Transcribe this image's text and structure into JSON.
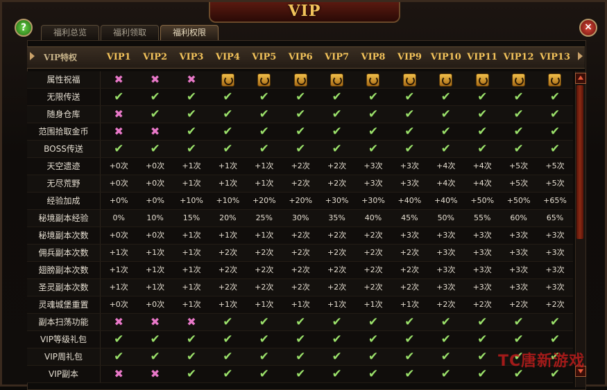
{
  "window": {
    "title": "VIP",
    "help_glyph": "?",
    "close_glyph": "×"
  },
  "tabs": [
    {
      "label": "福利总览",
      "active": false
    },
    {
      "label": "福利领取",
      "active": false
    },
    {
      "label": "福利权限",
      "active": true
    }
  ],
  "header": {
    "corner_label": "VIP特权",
    "columns": [
      "VIP1",
      "VIP2",
      "VIP3",
      "VIP4",
      "VIP5",
      "VIP6",
      "VIP7",
      "VIP8",
      "VIP9",
      "VIP10",
      "VIP11",
      "VIP12",
      "VIP13"
    ]
  },
  "icons": {
    "check": "✔",
    "cross": "✖"
  },
  "colors": {
    "accent": "#f2c25a",
    "check": "#9ae06a",
    "cross": "#e878c8"
  },
  "rows": [
    {
      "label": "属性祝福",
      "values": [
        "x",
        "x",
        "x",
        "s",
        "s",
        "s",
        "s",
        "s",
        "s",
        "s",
        "s",
        "s",
        "s"
      ]
    },
    {
      "label": "无限传送",
      "values": [
        "c",
        "c",
        "c",
        "c",
        "c",
        "c",
        "c",
        "c",
        "c",
        "c",
        "c",
        "c",
        "c"
      ]
    },
    {
      "label": "随身仓库",
      "values": [
        "x",
        "c",
        "c",
        "c",
        "c",
        "c",
        "c",
        "c",
        "c",
        "c",
        "c",
        "c",
        "c"
      ]
    },
    {
      "label": "范围拾取金币",
      "values": [
        "x",
        "x",
        "c",
        "c",
        "c",
        "c",
        "c",
        "c",
        "c",
        "c",
        "c",
        "c",
        "c"
      ]
    },
    {
      "label": "BOSS传送",
      "values": [
        "c",
        "c",
        "c",
        "c",
        "c",
        "c",
        "c",
        "c",
        "c",
        "c",
        "c",
        "c",
        "c"
      ]
    },
    {
      "label": "天空遗迹",
      "values": [
        "+0次",
        "+0次",
        "+1次",
        "+1次",
        "+1次",
        "+2次",
        "+2次",
        "+3次",
        "+3次",
        "+4次",
        "+4次",
        "+5次",
        "+5次"
      ]
    },
    {
      "label": "无尽荒野",
      "values": [
        "+0次",
        "+0次",
        "+1次",
        "+1次",
        "+1次",
        "+2次",
        "+2次",
        "+3次",
        "+3次",
        "+4次",
        "+4次",
        "+5次",
        "+5次"
      ]
    },
    {
      "label": "经验加成",
      "values": [
        "+0%",
        "+0%",
        "+10%",
        "+10%",
        "+20%",
        "+20%",
        "+30%",
        "+30%",
        "+40%",
        "+40%",
        "+50%",
        "+50%",
        "+65%"
      ]
    },
    {
      "label": "秘境副本经验",
      "values": [
        "0%",
        "10%",
        "15%",
        "20%",
        "25%",
        "30%",
        "35%",
        "40%",
        "45%",
        "50%",
        "55%",
        "60%",
        "65%"
      ]
    },
    {
      "label": "秘境副本次数",
      "values": [
        "+0次",
        "+0次",
        "+1次",
        "+1次",
        "+1次",
        "+2次",
        "+2次",
        "+2次",
        "+3次",
        "+3次",
        "+3次",
        "+3次",
        "+3次"
      ]
    },
    {
      "label": "佣兵副本次数",
      "values": [
        "+1次",
        "+1次",
        "+1次",
        "+2次",
        "+2次",
        "+2次",
        "+2次",
        "+2次",
        "+2次",
        "+3次",
        "+3次",
        "+3次",
        "+3次"
      ]
    },
    {
      "label": "翅膀副本次数",
      "values": [
        "+1次",
        "+1次",
        "+1次",
        "+2次",
        "+2次",
        "+2次",
        "+2次",
        "+2次",
        "+2次",
        "+3次",
        "+3次",
        "+3次",
        "+3次"
      ]
    },
    {
      "label": "圣灵副本次数",
      "values": [
        "+1次",
        "+1次",
        "+1次",
        "+2次",
        "+2次",
        "+2次",
        "+2次",
        "+2次",
        "+2次",
        "+3次",
        "+3次",
        "+3次",
        "+3次"
      ]
    },
    {
      "label": "灵魂城堡重置",
      "values": [
        "+0次",
        "+0次",
        "+1次",
        "+1次",
        "+1次",
        "+1次",
        "+1次",
        "+1次",
        "+1次",
        "+2次",
        "+2次",
        "+2次",
        "+2次"
      ]
    },
    {
      "label": "副本扫荡功能",
      "values": [
        "x",
        "x",
        "x",
        "c",
        "c",
        "c",
        "c",
        "c",
        "c",
        "c",
        "c",
        "c",
        "c"
      ]
    },
    {
      "label": "VIP等级礼包",
      "values": [
        "c",
        "c",
        "c",
        "c",
        "c",
        "c",
        "c",
        "c",
        "c",
        "c",
        "c",
        "c",
        "c"
      ]
    },
    {
      "label": "VIP周礼包",
      "values": [
        "c",
        "c",
        "c",
        "c",
        "c",
        "c",
        "c",
        "c",
        "c",
        "c",
        "c",
        "c",
        "c"
      ]
    },
    {
      "label": "VIP副本",
      "values": [
        "x",
        "x",
        "c",
        "c",
        "c",
        "c",
        "c",
        "c",
        "c",
        "c",
        "c",
        "c",
        "c"
      ]
    }
  ],
  "watermark": "TC唐新游戏"
}
